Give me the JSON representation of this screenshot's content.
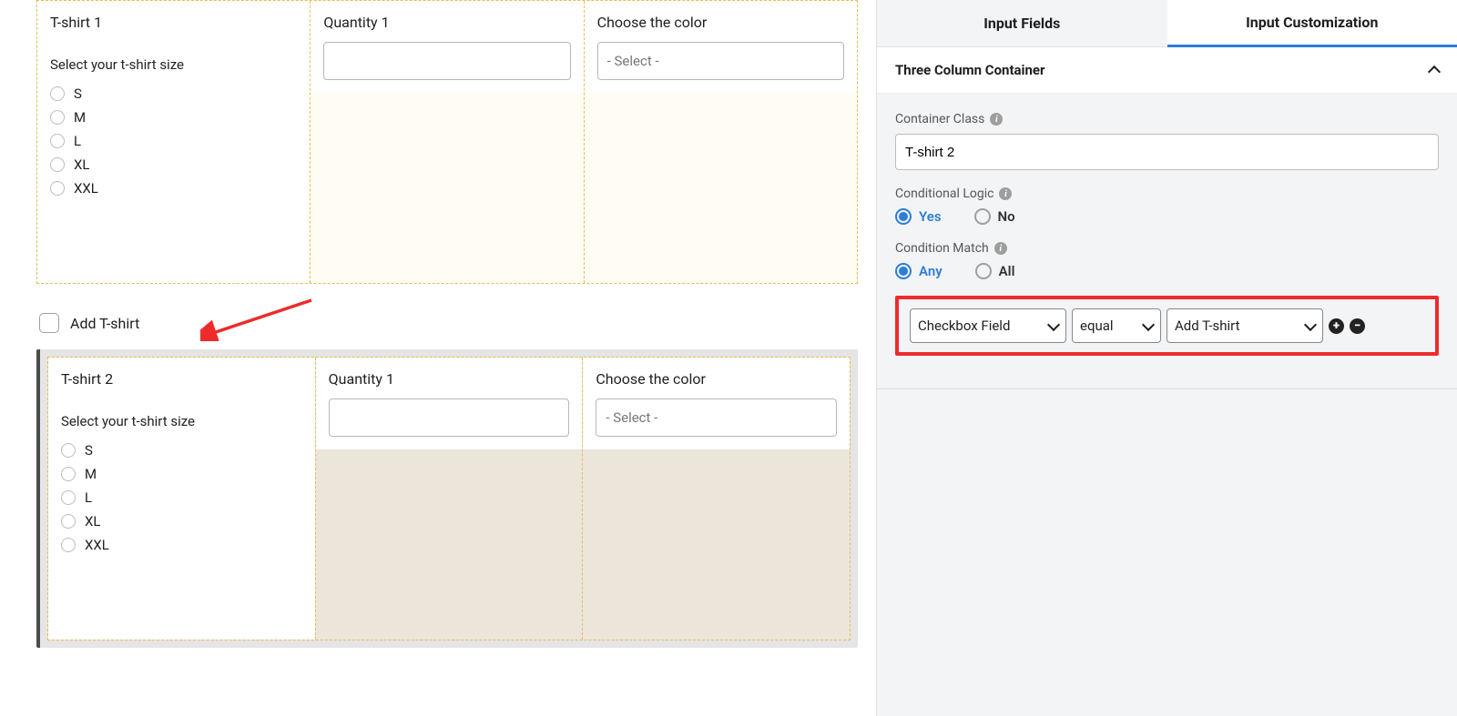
{
  "form": {
    "container1": {
      "title": "T-shirt 1",
      "size_label": "Select your t-shirt size",
      "sizes": [
        "S",
        "M",
        "L",
        "XL",
        "XXL"
      ],
      "qty_label": "Quantity 1",
      "color_label": "Choose the color",
      "select_placeholder": "- Select -"
    },
    "checkbox": {
      "label": "Add T-shirt"
    },
    "container2": {
      "title": "T-shirt 2",
      "size_label": "Select your t-shirt size",
      "sizes": [
        "S",
        "M",
        "L",
        "XL",
        "XXL"
      ],
      "qty_label": "Quantity 1",
      "color_label": "Choose the color",
      "select_placeholder": "- Select -"
    }
  },
  "panel": {
    "tabs": {
      "fields": "Input Fields",
      "custom": "Input Customization"
    },
    "section_title": "Three Column Container",
    "container_class": {
      "label": "Container Class",
      "value": "T-shirt 2"
    },
    "conditional_logic": {
      "label": "Conditional Logic",
      "yes": "Yes",
      "no": "No"
    },
    "condition_match": {
      "label": "Condition Match",
      "any": "Any",
      "all": "All"
    },
    "rule": {
      "field": "Checkbox Field",
      "op": "equal",
      "value": "Add T-shirt"
    }
  }
}
